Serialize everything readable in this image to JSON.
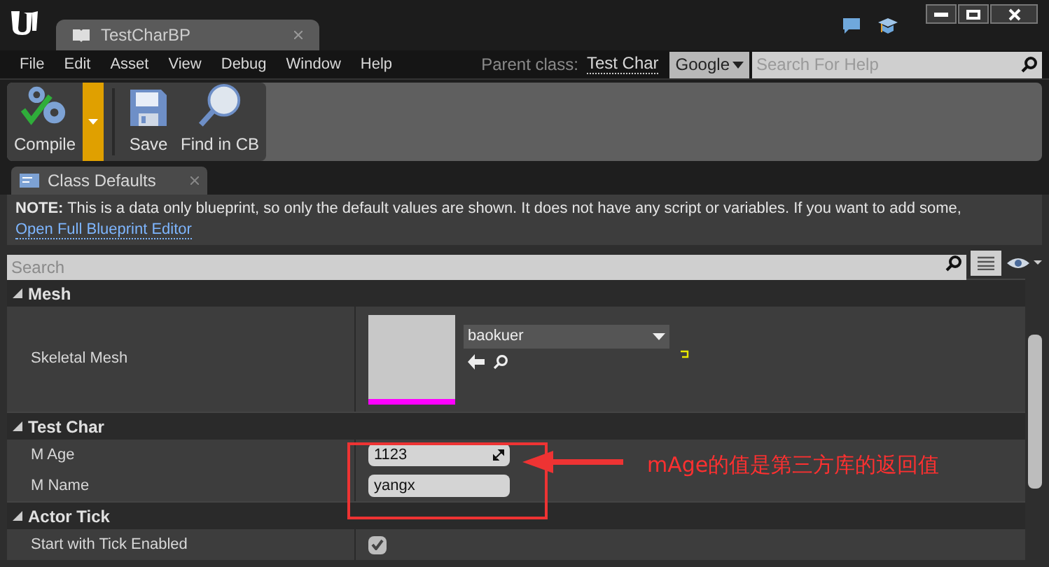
{
  "document_tab": {
    "title": "TestCharBP"
  },
  "menu": [
    "File",
    "Edit",
    "Asset",
    "View",
    "Debug",
    "Window",
    "Help"
  ],
  "parent_class": {
    "label": "Parent class:",
    "value": "Test Char"
  },
  "help_search": {
    "provider": "Google",
    "placeholder": "Search For Help"
  },
  "toolbar": [
    {
      "label": "Compile",
      "kind": "compile"
    },
    {
      "label": "Save",
      "kind": "save"
    },
    {
      "label": "Find in CB",
      "kind": "find"
    }
  ],
  "panel_tab": {
    "title": "Class Defaults"
  },
  "note": {
    "text": "**NOTE:** This is a data only blueprint, so only the default values are shown.  It does not have any script or variables.  If you want to add some,",
    "link": "Open Full Blueprint Editor"
  },
  "search": {
    "placeholder": "Search"
  },
  "categories": [
    {
      "title": "Mesh",
      "expanded": true,
      "properties": [
        {
          "label": "Skeletal Mesh",
          "kind": "asset",
          "value": "baokuer"
        }
      ]
    },
    {
      "title": "Test Char",
      "expanded": true,
      "properties": [
        {
          "label": "M Age",
          "kind": "number",
          "value": "1123"
        },
        {
          "label": "M Name",
          "kind": "text",
          "value": "yangx"
        }
      ]
    },
    {
      "title": "Actor Tick",
      "expanded": true,
      "properties": [
        {
          "label": "Start with Tick Enabled",
          "kind": "checkbox",
          "checked": true
        }
      ]
    }
  ],
  "annotation": {
    "text": "mAge的值是第三方库的返回值"
  }
}
